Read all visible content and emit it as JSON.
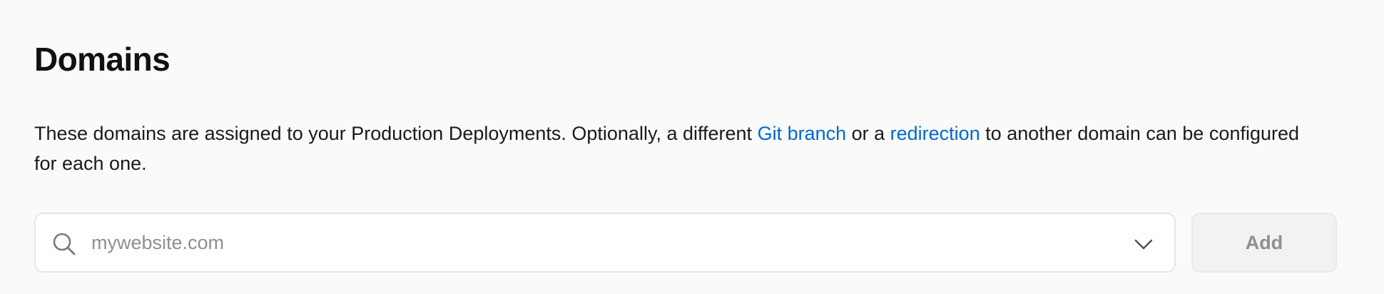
{
  "section": {
    "title": "Domains",
    "description": {
      "text_before": "These domains are assigned to your Production Deployments. Optionally, a different ",
      "link_git_branch": "Git branch",
      "text_middle": " or a ",
      "link_redirection": "redirection",
      "text_after": " to another domain can be configured for each one."
    }
  },
  "domain_input": {
    "value": "",
    "placeholder": "mywebsite.com",
    "icon": "search-icon",
    "dropdown_icon": "chevron-down-icon"
  },
  "add_button": {
    "label": "Add",
    "disabled": true
  },
  "colors": {
    "background": "#fafafa",
    "link": "#0068d6",
    "placeholder": "#8f8f8f",
    "button_disabled_bg": "#f2f2f2"
  }
}
